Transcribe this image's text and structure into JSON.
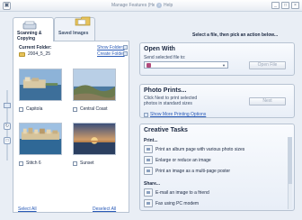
{
  "titlebar": {
    "help_link": "Manage Features (Help)",
    "help_label": "Help",
    "window_buttons": [
      "_",
      "□",
      "×"
    ]
  },
  "tabs": [
    {
      "label": "Scanning & Copying",
      "active": true
    },
    {
      "label": "Saved Images",
      "active": false
    }
  ],
  "left_panel": {
    "current_folder_label": "Current Folder:",
    "current_folder": "2004_5_25",
    "show_folders": "Show Folders",
    "create_folder": "Create Folder",
    "thumbnails": [
      {
        "caption": "Capitola"
      },
      {
        "caption": "Central Coast"
      },
      {
        "caption": "Stitch 6"
      },
      {
        "caption": "Sunset"
      }
    ],
    "select_all": "Select All",
    "deselect_all": "Deselect All"
  },
  "prompt": "Select a file, then pick an action below...",
  "open_with": {
    "title": "Open With",
    "subtitle": "Send selected file to:",
    "selected_app": "",
    "button": "Open File"
  },
  "photo_prints": {
    "title": "Photo Prints...",
    "description": "Click Next to print selected photos in standard sizes",
    "button": "Next",
    "show_more": "Show More Printing Options"
  },
  "creative_tasks": {
    "title": "Creative Tasks",
    "print_label": "Print...",
    "print_items": [
      "Print an album page with various photo sizes",
      "Enlarge or reduce an image",
      "Print an image as a multi-page poster"
    ],
    "share_label": "Share...",
    "share_items": [
      "E-mail an image to a friend",
      "Fax using PC modem"
    ]
  },
  "colors": {
    "accent": "#2a5bb8",
    "panel_border": "#b7c3d2",
    "background": "#e9eef5"
  }
}
